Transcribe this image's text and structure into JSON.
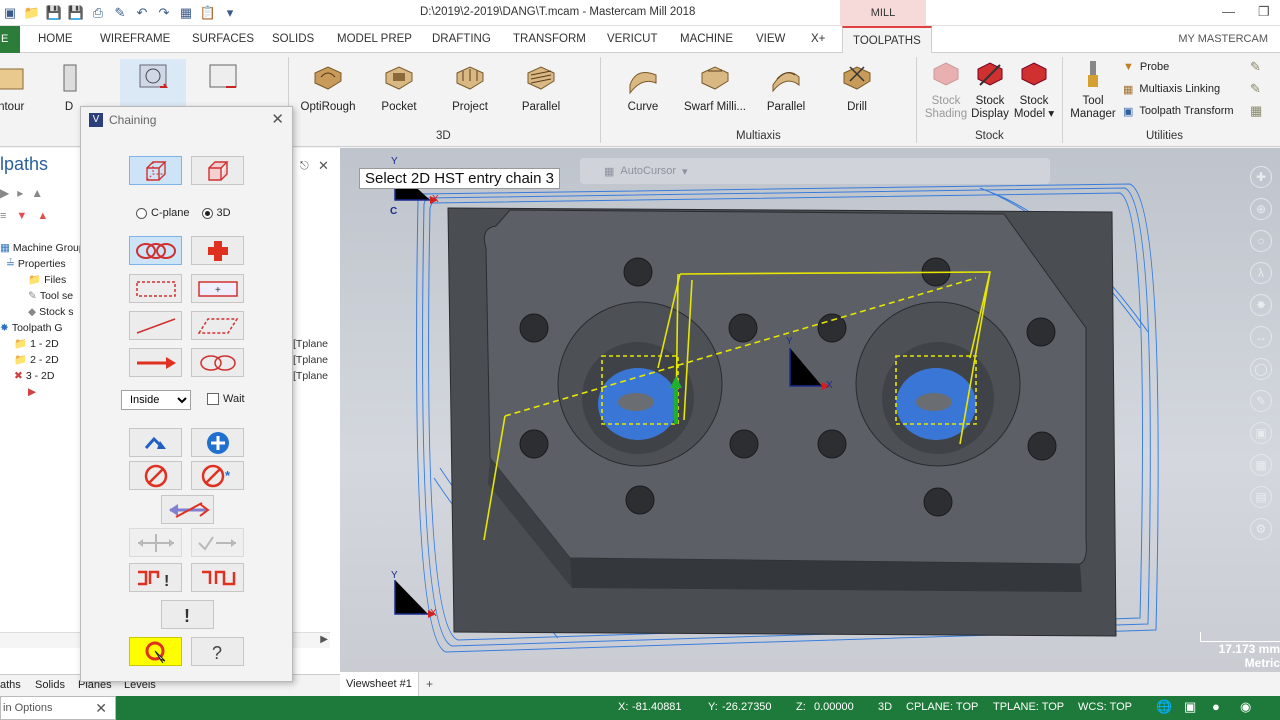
{
  "window": {
    "title": "D:\\2019\\2-2019\\DANG\\T.mcam - Mastercam Mill 2018",
    "context_tag": "MILL"
  },
  "tabs": {
    "file": "E",
    "items": [
      "HOME",
      "WIREFRAME",
      "SURFACES",
      "SOLIDS",
      "MODEL PREP",
      "DRAFTING",
      "TRANSFORM",
      "VERICUT",
      "MACHINE",
      "VIEW",
      "X+",
      "TOOLPATHS"
    ],
    "active": "TOOLPATHS",
    "account": "MY MASTERCAM"
  },
  "ribbon": {
    "partial_left": [
      "ontour",
      "D"
    ],
    "group_3d": {
      "label": "3D",
      "buttons": [
        "OptiRough",
        "Pocket",
        "Project",
        "Parallel"
      ]
    },
    "group_multiaxis": {
      "label": "Multiaxis",
      "buttons": [
        "Curve",
        "Swarf Milli...",
        "Parallel",
        "Drill"
      ]
    },
    "group_stock": {
      "label": "Stock",
      "buttons": [
        {
          "line1": "Stock",
          "line2": "Shading"
        },
        {
          "line1": "Stock",
          "line2": "Display"
        },
        {
          "line1": "Stock",
          "line2": "Model ▾"
        }
      ]
    },
    "group_utilities": {
      "label": "Utilities",
      "tool_manager": {
        "line1": "Tool",
        "line2": "Manager"
      },
      "items": [
        "Probe",
        "Multiaxis Linking",
        "Toolpath Transform"
      ]
    }
  },
  "manager": {
    "title": "lpaths",
    "tree": {
      "machine_group": "Machine Group",
      "properties": "Properties",
      "files": "Files",
      "tool_settings": "Tool se",
      "stock": "Stock s",
      "toolpath_group": "Toolpath G",
      "ops": [
        "1 - 2D",
        "2 - 2D",
        "3 - 2D"
      ],
      "tplane": "[Tplane"
    },
    "bottom_tabs": [
      "aths",
      "Solids",
      "Planes",
      "Levels"
    ]
  },
  "chaining": {
    "title": "Chaining",
    "radio_cplane": "C-plane",
    "radio_3d": "3D",
    "selected_radio": "3D",
    "mode_select": "Inside",
    "wait_label": "Wait"
  },
  "viewport": {
    "prompt": "Select 2D HST entry chain 3",
    "scale_value": "17.173 mm",
    "scale_units": "Metric",
    "autocursor": "AutoCursor",
    "axis_x": "X",
    "axis_y": "Y",
    "axis_c": "C",
    "viewsheet": "Viewsheet #1",
    "add_sheet": "+"
  },
  "status": {
    "chain_options": "in Options",
    "x_label": "X:",
    "x_value": "-81.40881",
    "y_label": "Y:",
    "y_value": "-26.27350",
    "z_label": "Z:",
    "z_value": "0.00000",
    "mode": "3D",
    "cplane": "CPLANE: TOP",
    "tplane": "TPLANE: TOP",
    "wcs": "WCS: TOP"
  },
  "colors": {
    "accent_green": "#1e7a3a",
    "toolpath_blue": "#1f6fe0",
    "chain_yellow": "#e6e600",
    "active_tab_red": "#e14040"
  }
}
